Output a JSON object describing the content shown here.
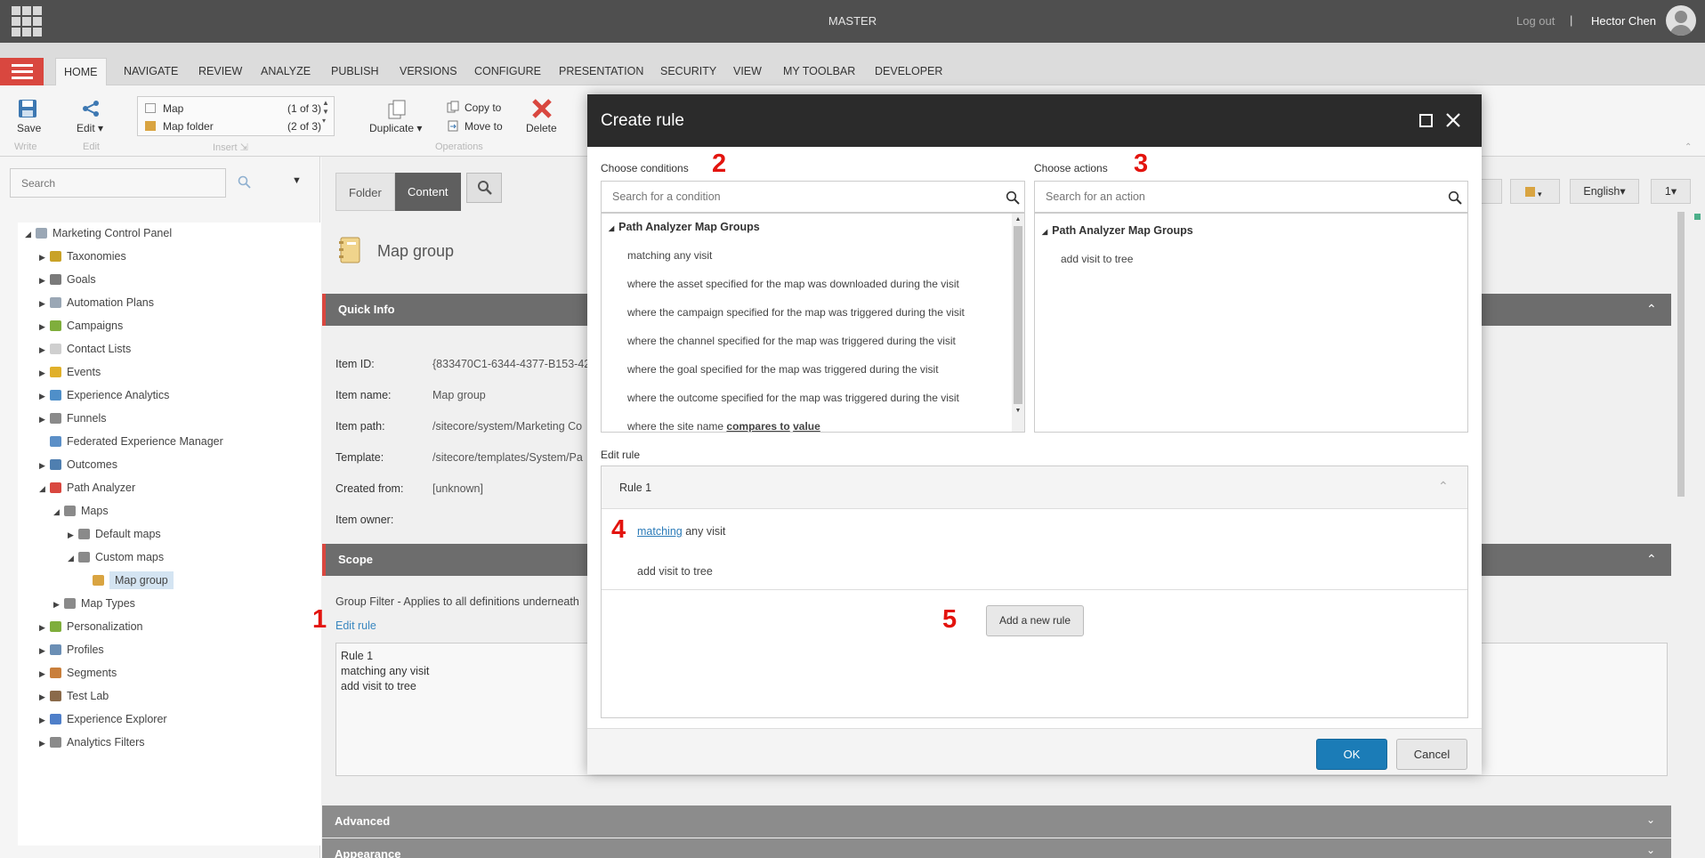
{
  "topbar": {
    "title": "MASTER",
    "logout": "Log out",
    "separator": "|",
    "user": "Hector Chen"
  },
  "ribbon_tabs": [
    "HOME",
    "NAVIGATE",
    "REVIEW",
    "ANALYZE",
    "PUBLISH",
    "VERSIONS",
    "CONFIGURE",
    "PRESENTATION",
    "SECURITY",
    "VIEW",
    "MY TOOLBAR",
    "DEVELOPER"
  ],
  "ribbon": {
    "save": "Save",
    "write_group": "Write",
    "edit": "Edit",
    "edit_group": "Edit",
    "insert_items": [
      {
        "label": "Map",
        "count": "(1 of 3)"
      },
      {
        "label": "Map folder",
        "count": "(2 of 3)"
      }
    ],
    "insert_group": "Insert",
    "duplicate": "Duplicate",
    "copy_to": "Copy to",
    "move_to": "Move to",
    "delete": "Delete",
    "operations_group": "Operations"
  },
  "left": {
    "search_placeholder": "Search"
  },
  "tree": [
    {
      "label": "Marketing Control Panel",
      "color": "#9aa7b5"
    },
    {
      "label": "Taxonomies",
      "color": "#c9a227"
    },
    {
      "label": "Goals",
      "color": "#7a7a7a"
    },
    {
      "label": "Automation Plans",
      "color": "#9aa7b5"
    },
    {
      "label": "Campaigns",
      "color": "#7fae3c"
    },
    {
      "label": "Contact Lists",
      "color": "#cfcfcf"
    },
    {
      "label": "Events",
      "color": "#e0b02a"
    },
    {
      "label": "Experience Analytics",
      "color": "#4f8fc9"
    },
    {
      "label": "Funnels",
      "color": "#8a8a8a"
    },
    {
      "label": "Federated Experience Manager",
      "color": "#5b8fc7"
    },
    {
      "label": "Outcomes",
      "color": "#4f7fb0"
    },
    {
      "label": "Path Analyzer",
      "color": "#d9473f"
    },
    {
      "label": "Maps",
      "color": "#8a8a8a"
    },
    {
      "label": "Default maps",
      "color": "#8a8a8a"
    },
    {
      "label": "Custom maps",
      "color": "#8a8a8a"
    },
    {
      "label": "Map group",
      "color": "#d9a441"
    },
    {
      "label": "Map Types",
      "color": "#8a8a8a"
    },
    {
      "label": "Personalization",
      "color": "#7fae3c"
    },
    {
      "label": "Profiles",
      "color": "#6b8fb5"
    },
    {
      "label": "Segments",
      "color": "#c97f3c"
    },
    {
      "label": "Test Lab",
      "color": "#8a6a4a"
    },
    {
      "label": "Experience Explorer",
      "color": "#4f7fc9"
    },
    {
      "label": "Analytics Filters",
      "color": "#8a8a8a"
    }
  ],
  "editor": {
    "tabs": [
      "Folder",
      "Content"
    ],
    "item_title": "Map group",
    "quick_info": "Quick Info",
    "fields": [
      {
        "label": "Item ID:",
        "value": "{833470C1-6344-4377-B153-42"
      },
      {
        "label": "Item name:",
        "value": "Map group"
      },
      {
        "label": "Item path:",
        "value": "/sitecore/system/Marketing Co"
      },
      {
        "label": "Template:",
        "value": "/sitecore/templates/System/Pa"
      },
      {
        "label": "Created from:",
        "value": "[unknown]"
      },
      {
        "label": "Item owner:",
        "value": ""
      }
    ],
    "scope": "Scope",
    "group_filter": "Group Filter - Applies to all definitions underneath",
    "callout_1": "1",
    "edit_rule_link": "Edit rule",
    "rule_text": [
      "Rule 1",
      "matching any visit",
      "add visit to tree"
    ],
    "advanced": "Advanced",
    "appearance": "Appearance",
    "right_controls": {
      "language": "English",
      "version": "1"
    }
  },
  "dialog": {
    "title": "Create rule",
    "choose_conditions": "Choose conditions",
    "callout_2": "2",
    "condition_placeholder": "Search for a condition",
    "condition_group": "Path Analyzer Map Groups",
    "conditions": [
      "matching any visit",
      "where the asset specified for the map was downloaded during the visit",
      "where the campaign specified for the map was triggered during the visit",
      "where the channel specified for the map was triggered during the visit",
      "where the goal specified for the map was triggered during the visit",
      "where the outcome specified for the map was triggered during the visit"
    ],
    "condition_last": {
      "prefix": "where the site name",
      "link1": "compares to",
      "link2": "value"
    },
    "choose_actions": "Choose actions",
    "callout_3": "3",
    "action_placeholder": "Search for an action",
    "action_group": "Path Analyzer Map Groups",
    "actions": [
      "add visit to tree"
    ],
    "edit_rule": "Edit rule",
    "rule_title": "Rule 1",
    "callout_4": "4",
    "rule_condition_link": "matching",
    "rule_condition_rest": "any visit",
    "rule_action": "add visit to tree",
    "callout_5": "5",
    "add_rule": "Add a new rule",
    "ok": "OK",
    "cancel": "Cancel"
  },
  "colors": {
    "accent": "#d9473f",
    "ok": "#1b7cb7",
    "callout": "#e3140e"
  }
}
